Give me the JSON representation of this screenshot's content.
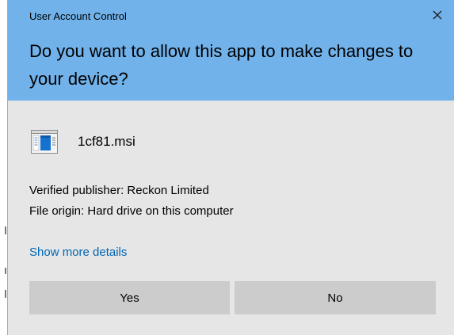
{
  "window": {
    "title": "User Account Control",
    "close_icon": "close-icon",
    "header_color": "#71b2ea",
    "body_color": "#e6e6e6"
  },
  "prompt": {
    "question": "Do you want to allow this app to make changes to your device?"
  },
  "app": {
    "icon": "installer-file-icon",
    "name": "1cf81.msi"
  },
  "details": {
    "publisher": "Verified publisher: Reckon Limited",
    "origin": "File origin: Hard drive on this computer"
  },
  "links": {
    "show_more": "Show more details",
    "link_color": "#0066b4"
  },
  "buttons": {
    "yes_label": "Yes",
    "no_label": "No",
    "button_color": "#cccccc"
  }
}
